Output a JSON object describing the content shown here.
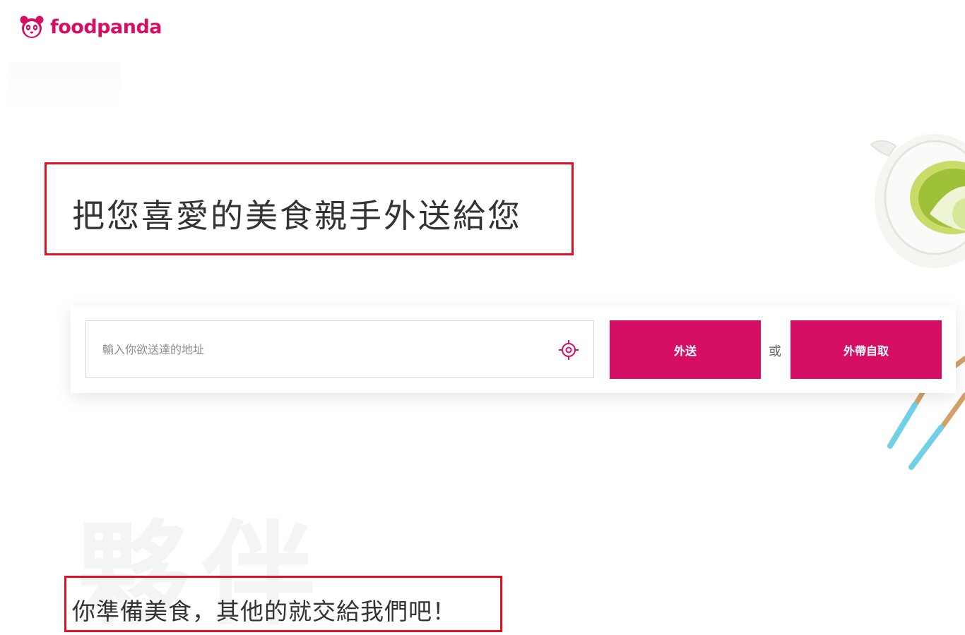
{
  "brand": {
    "name": "foodpanda",
    "color": "#d70f64"
  },
  "hero": {
    "headline": "把您喜愛的美食親手外送給您"
  },
  "search": {
    "address_placeholder": "輸入你欲送達的地址",
    "locate_icon": "crosshair-icon",
    "delivery_label": "外送",
    "or_label": "或",
    "pickup_label": "外帶自取"
  },
  "section": {
    "watermark": "夥伴",
    "subheadline": "你準備美食，其他的就交給我們吧！"
  },
  "annotation_color": "#e3101f"
}
